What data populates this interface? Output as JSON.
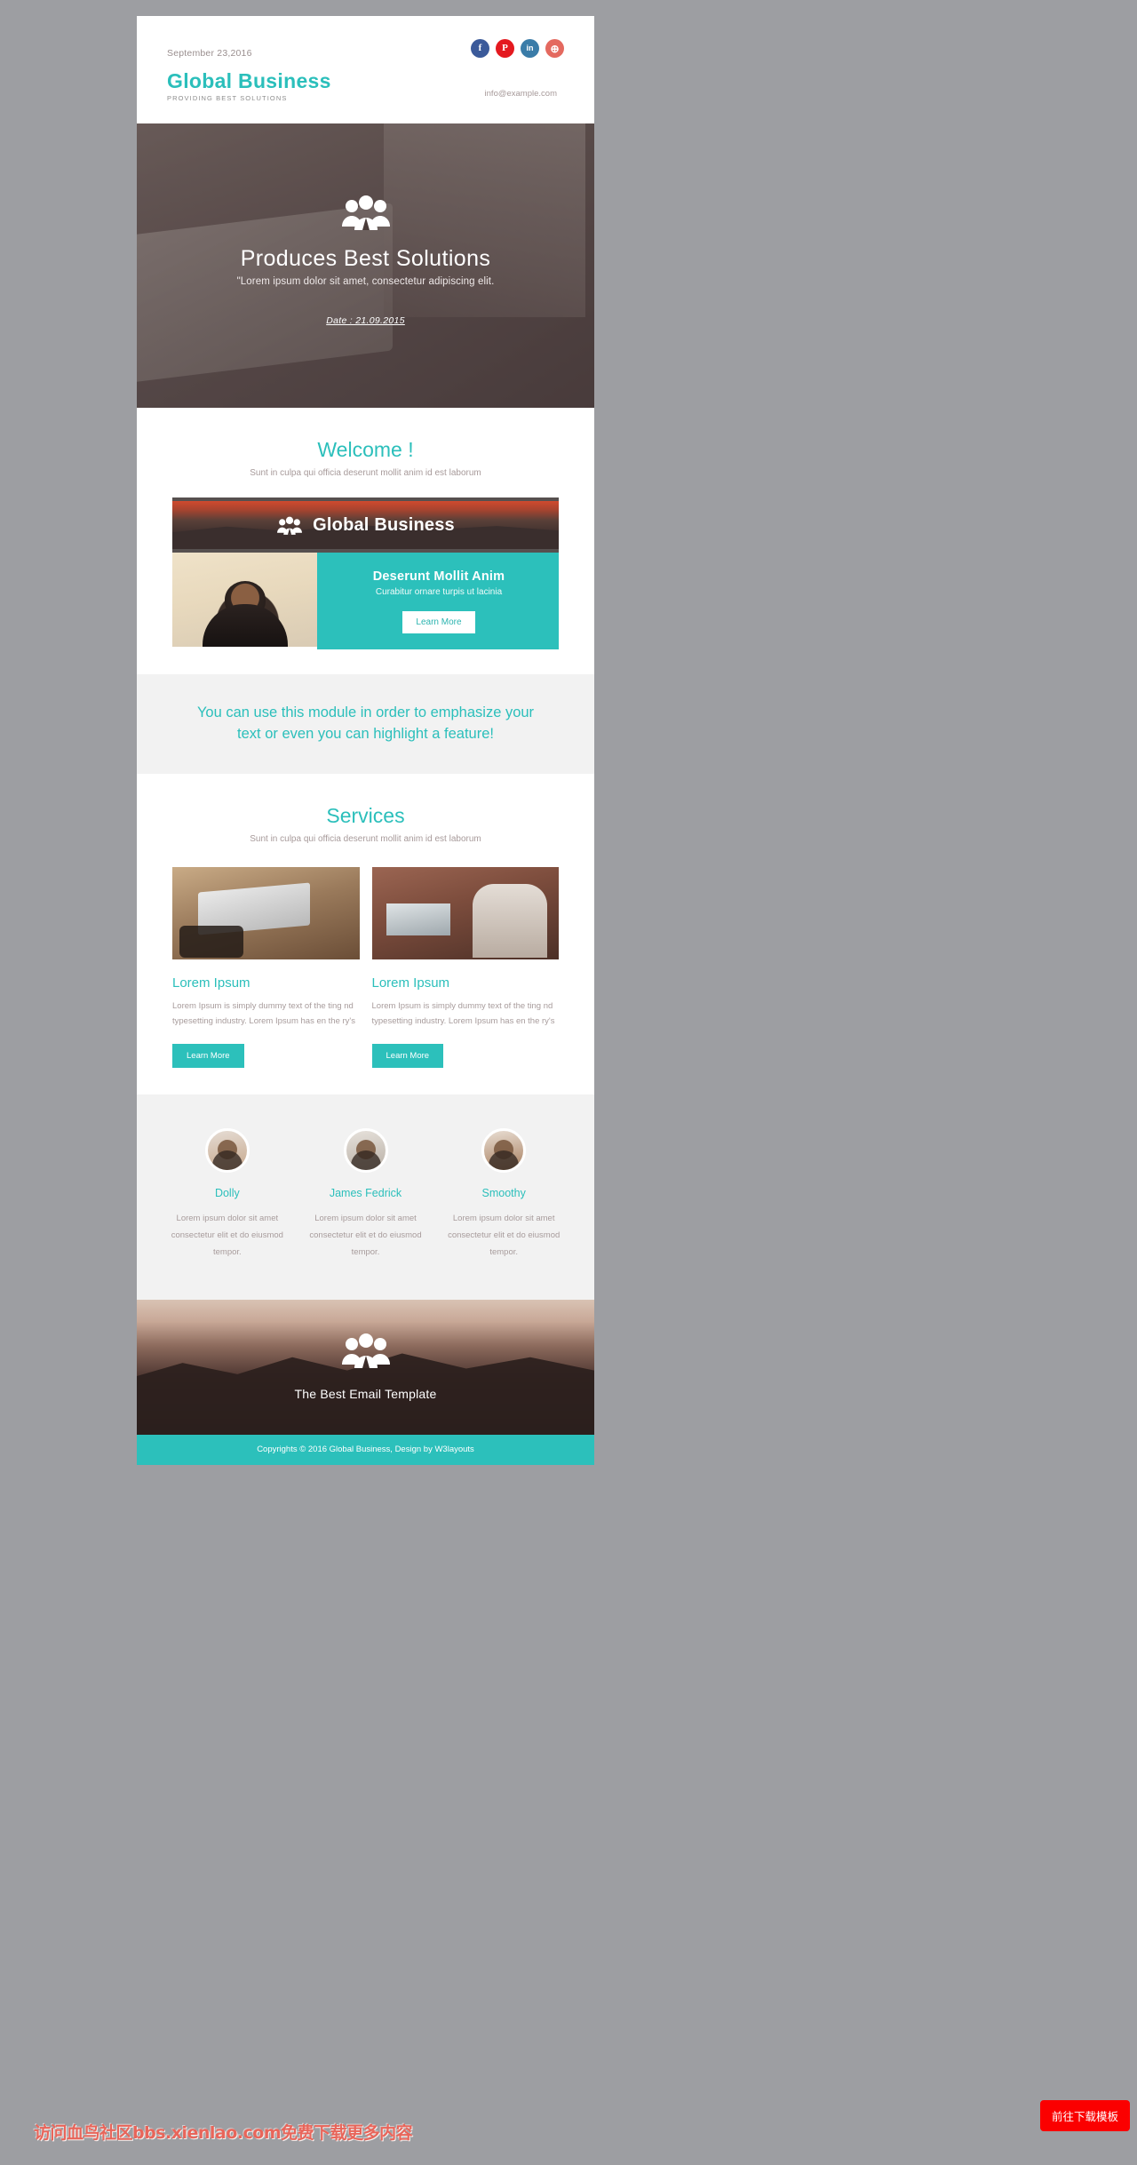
{
  "header": {
    "date": "September 23,2016",
    "logo_main": "Global Business",
    "logo_sub": "PROVIDING BEST SOLUTIONS",
    "email": "info@example.com",
    "socials": [
      {
        "name": "facebook",
        "glyph": "f",
        "color": "#3b5a9a"
      },
      {
        "name": "pinterest",
        "glyph": "P",
        "color": "#e4191f"
      },
      {
        "name": "linkedin",
        "glyph": "in",
        "color": "#3a7ca8"
      },
      {
        "name": "dribbble",
        "glyph": "⊕",
        "color": "#e4695f"
      }
    ]
  },
  "hero": {
    "title": "Produces Best Solutions",
    "subtitle": "\"Lorem ipsum dolor sit amet, consectetur adipiscing elit.",
    "date": "Date : 21.09.2015"
  },
  "welcome": {
    "title": "Welcome !",
    "subtitle": "Sunt in culpa qui officia deserunt mollit anim id est laborum",
    "card": {
      "banner_title": "Global Business",
      "heading": "Deserunt Mollit Anim",
      "text": "Curabitur ornare turpis ut lacinia",
      "button": "Learn More"
    }
  },
  "highlight": {
    "text": "You can use this module in order to emphasize your text or even you can highlight a feature!"
  },
  "services": {
    "title": "Services",
    "subtitle": "Sunt in culpa qui officia deserunt mollit anim id est laborum",
    "items": [
      {
        "heading": "Lorem Ipsum",
        "text": "Lorem Ipsum is simply dummy text of the ting nd typesetting industry. Lorem Ipsum has en the ry's",
        "button": "Learn More"
      },
      {
        "heading": "Lorem Ipsum",
        "text": "Lorem Ipsum is simply dummy text of the ting nd typesetting industry. Lorem Ipsum has en the ry's",
        "button": "Learn More"
      }
    ]
  },
  "team": {
    "members": [
      {
        "name": "Dolly",
        "text": "Lorem ipsum dolor sit amet consectetur elit et do eiusmod tempor."
      },
      {
        "name": "James Fedrick",
        "text": "Lorem ipsum dolor sit amet consectetur elit et do eiusmod tempor."
      },
      {
        "name": "Smoothy",
        "text": "Lorem ipsum dolor sit amet consectetur elit et do eiusmod tempor."
      }
    ]
  },
  "footer": {
    "title": "The Best Email Template",
    "copyright": "Copyrights © 2016 Global Business, Design by W3layouts"
  },
  "overlay": {
    "watermark": "访问血鸟社区bbs.xienlao.com免费下载更多内容",
    "download_button": "前往下载模板"
  },
  "colors": {
    "accent": "#2cc0bb",
    "muted": "#a89c9c",
    "download": "#fb0000"
  }
}
